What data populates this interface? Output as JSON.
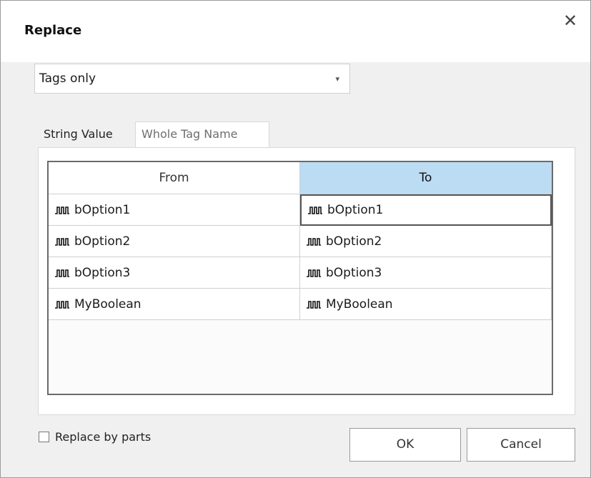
{
  "window": {
    "title": "Replace",
    "close_glyph": "✕"
  },
  "scope_select": {
    "value": "Tags only",
    "arrow_glyph": "▾"
  },
  "tabs": [
    {
      "label": "String Value",
      "active": false
    },
    {
      "label": "Whole Tag Name",
      "active": true
    }
  ],
  "grid": {
    "columns": [
      "From",
      "To"
    ],
    "rows": [
      {
        "from": "bOption1",
        "to": "bOption1"
      },
      {
        "from": "bOption2",
        "to": "bOption2"
      },
      {
        "from": "bOption3",
        "to": "bOption3"
      },
      {
        "from": "MyBoolean",
        "to": "MyBoolean"
      }
    ],
    "row_icon": "boolean-tag-icon",
    "header_highlight_color": "#bcdcf4"
  },
  "replace_by_parts": {
    "label": "Replace by parts",
    "checked": false
  },
  "buttons": {
    "ok": "OK",
    "cancel": "Cancel"
  }
}
